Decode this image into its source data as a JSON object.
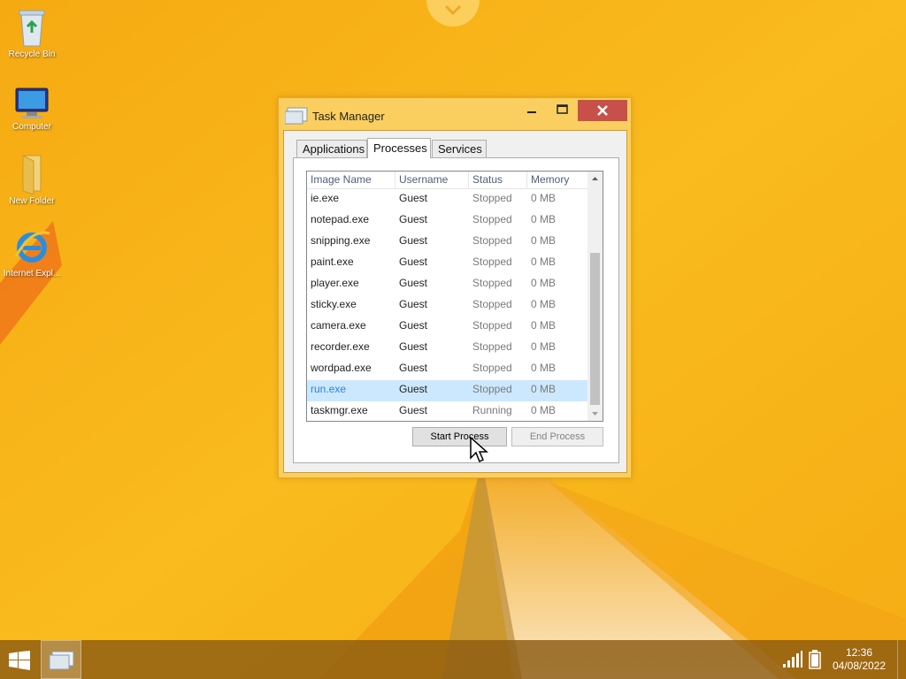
{
  "desktop": {
    "icons": [
      {
        "label": "Recycle Bin",
        "icon": "recycle-bin-icon"
      },
      {
        "label": "Computer",
        "icon": "computer-icon"
      },
      {
        "label": "New Folder",
        "icon": "folder-icon"
      },
      {
        "label": "Internet Expl...",
        "icon": "internet-explorer-icon"
      }
    ],
    "wallpaper_colors": {
      "base": "#f7b517",
      "accent": "#ef7d1a",
      "light": "#fbe3b8"
    }
  },
  "window": {
    "title": "Task Manager",
    "close_color": "#c7504b",
    "tabs": [
      {
        "label": "Applications",
        "active": false
      },
      {
        "label": "Processes",
        "active": true
      },
      {
        "label": "Services",
        "active": false
      }
    ],
    "columns": [
      "Image Name",
      "Username",
      "Status",
      "Memory"
    ],
    "rows": [
      {
        "name": "ie.exe",
        "user": "Guest",
        "status": "Stopped",
        "memory": "0 MB",
        "selected": false
      },
      {
        "name": "notepad.exe",
        "user": "Guest",
        "status": "Stopped",
        "memory": "0 MB",
        "selected": false
      },
      {
        "name": "snipping.exe",
        "user": "Guest",
        "status": "Stopped",
        "memory": "0 MB",
        "selected": false
      },
      {
        "name": "paint.exe",
        "user": "Guest",
        "status": "Stopped",
        "memory": "0 MB",
        "selected": false
      },
      {
        "name": "player.exe",
        "user": "Guest",
        "status": "Stopped",
        "memory": "0 MB",
        "selected": false
      },
      {
        "name": "sticky.exe",
        "user": "Guest",
        "status": "Stopped",
        "memory": "0 MB",
        "selected": false
      },
      {
        "name": "camera.exe",
        "user": "Guest",
        "status": "Stopped",
        "memory": "0 MB",
        "selected": false
      },
      {
        "name": "recorder.exe",
        "user": "Guest",
        "status": "Stopped",
        "memory": "0 MB",
        "selected": false
      },
      {
        "name": "wordpad.exe",
        "user": "Guest",
        "status": "Stopped",
        "memory": "0 MB",
        "selected": false
      },
      {
        "name": "run.exe",
        "user": "Guest",
        "status": "Stopped",
        "memory": "0 MB",
        "selected": true
      },
      {
        "name": "taskmgr.exe",
        "user": "Guest",
        "status": "Running",
        "memory": "0 MB",
        "selected": false
      }
    ],
    "buttons": {
      "start": "Start Process",
      "end": "End Process",
      "end_enabled": false
    }
  },
  "taskbar": {
    "time": "12:36",
    "date": "04/08/2022"
  }
}
